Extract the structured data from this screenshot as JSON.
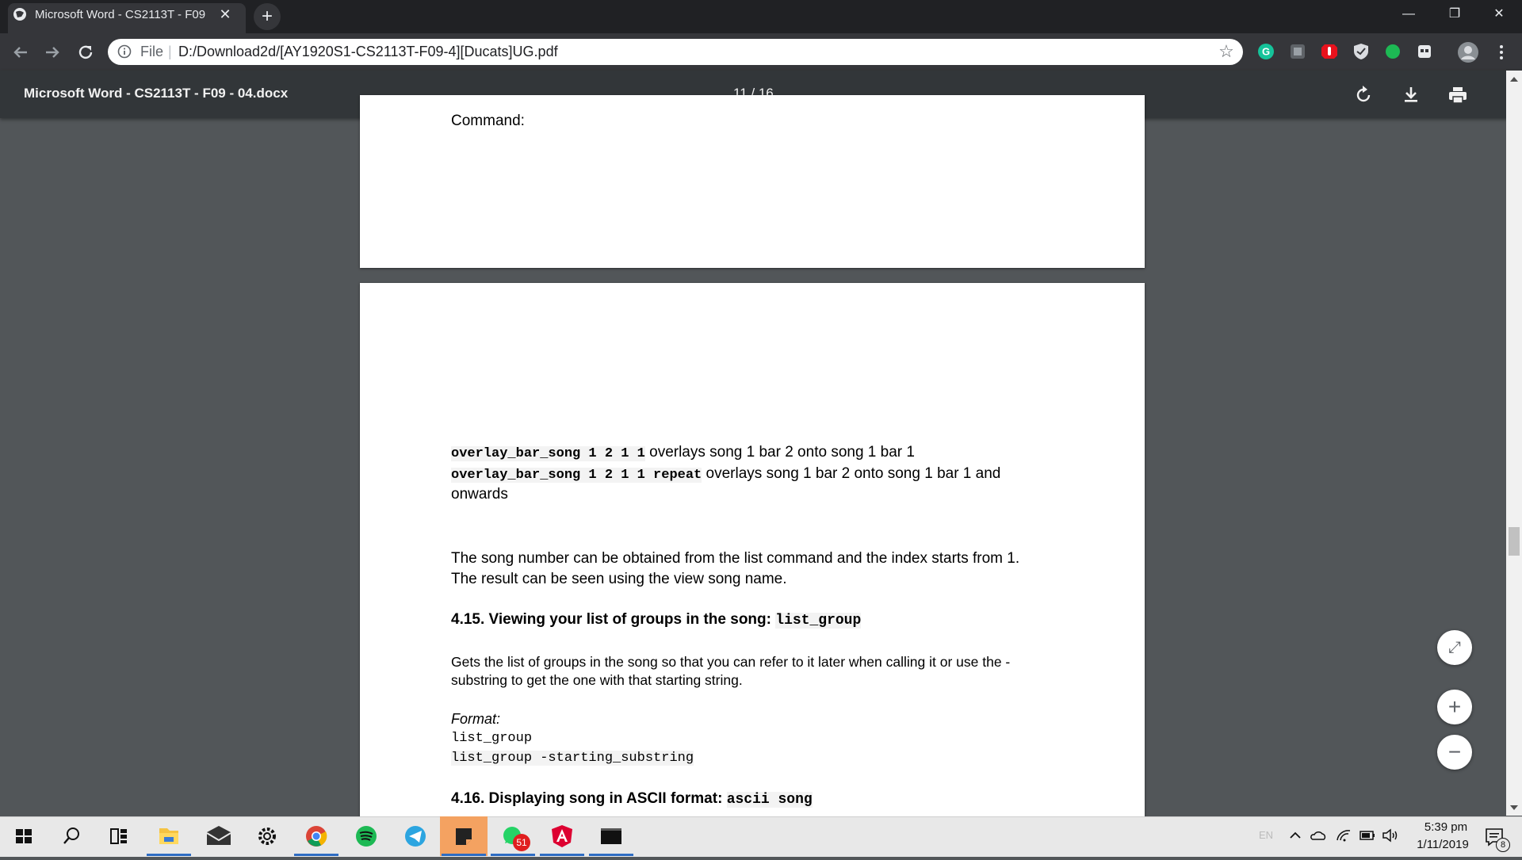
{
  "browser": {
    "tab_title": "Microsoft Word - CS2113T - F09",
    "tab_close": "✕",
    "new_tab": "+",
    "window": {
      "minimize": "—",
      "restore": "❐",
      "close": "✕"
    },
    "scheme_label": "File",
    "url_separator": "|",
    "url": "D:/Download2d/[AY1920S1-CS2113T-F09-4][Ducats]UG.pdf",
    "extensions": [
      "grammarly-icon",
      "extension-icon",
      "ublock-icon",
      "shield-icon",
      "green-dot-icon",
      "calendar-icon"
    ]
  },
  "pdf_viewer": {
    "doc_title": "Microsoft Word - CS2113T - F09 - 04.docx",
    "page_indicator": "11 / 16",
    "zoom_fit": "⤢",
    "zoom_in": "+",
    "zoom_out": "−"
  },
  "page_top": {
    "text": "Command:"
  },
  "page_main": {
    "line1_code": "overlay_bar_song 1 2 1 1",
    "line1_text": " overlays song 1 bar 2 onto song 1 bar 1",
    "line2_code": "overlay_bar_song 1 2 1 1 repeat",
    "line2_text": " overlays song 1 bar 2 onto song 1 bar 1 and",
    "line3_text": "onwards",
    "para1_line1": "The song number can be obtained from the list command and the index starts from 1.",
    "para1_line2": "The result can be seen using the view song name.",
    "heading1_text": "4.15. Viewing your list of groups in the song: ",
    "heading1_code": "list_group",
    "desc1_line1": "Gets the list of groups in the song so that you can refer to it later when calling it or use the -",
    "desc1_line2": "substring to get the one with that starting string.",
    "format_label": "Format:",
    "format_line1": "list_group",
    "format_line2": "list_group -starting_substring",
    "heading2_text": "4.16. Displaying song in ASCII format: ",
    "heading2_code": "ascii song"
  },
  "taskbar": {
    "whatsapp_badge": "51",
    "lang": "EN",
    "time": "5:39 pm",
    "date": "1/11/2019",
    "notif_count": "8"
  }
}
